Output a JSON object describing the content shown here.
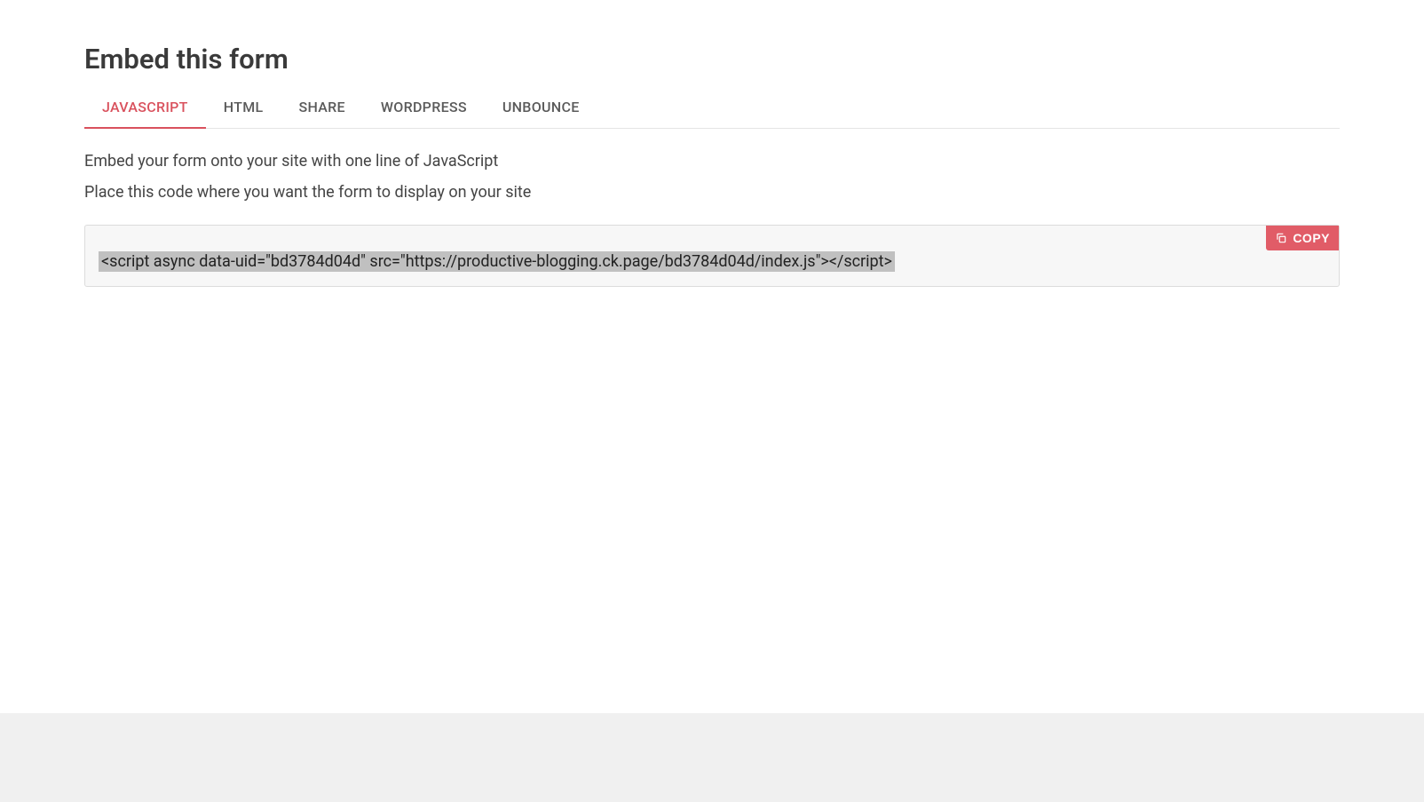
{
  "page": {
    "title": "Embed this form"
  },
  "tabs": [
    {
      "label": "JAVASCRIPT",
      "active": true
    },
    {
      "label": "HTML",
      "active": false
    },
    {
      "label": "SHARE",
      "active": false
    },
    {
      "label": "WORDPRESS",
      "active": false
    },
    {
      "label": "UNBOUNCE",
      "active": false
    }
  ],
  "content": {
    "description": "Embed your form onto your site with one line of JavaScript",
    "instruction": "Place this code where you want the form to display on your site",
    "code": "<script async data-uid=\"bd3784d04d\" src=\"https://productive-blogging.ck.page/bd3784d04d/index.js\"></script>"
  },
  "copy_button": {
    "label": "COPY"
  },
  "colors": {
    "accent": "#d9515d",
    "copy_button_bg": "#e15c67",
    "code_highlight": "#c0c0c0",
    "code_box_bg": "#f7f7f7",
    "border": "#dcdcdc"
  }
}
